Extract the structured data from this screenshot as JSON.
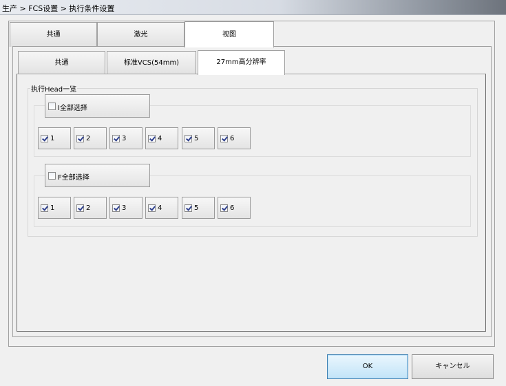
{
  "window": {
    "title": "生产 > FCS设置 > 执行条件设置"
  },
  "outer_tabs": [
    {
      "label": "共通",
      "active": false
    },
    {
      "label": "激光",
      "active": false
    },
    {
      "label": "视图",
      "active": true
    }
  ],
  "inner_tabs": [
    {
      "label": "共通",
      "active": false
    },
    {
      "label": "标准VCS(54mm)",
      "active": false
    },
    {
      "label": "27mm高分辨率",
      "active": true
    }
  ],
  "execution_group": {
    "title": "执行Head一览",
    "head_groups": [
      {
        "select_all": {
          "label": "I全部选择",
          "checked": false
        },
        "heads": [
          {
            "label": "1",
            "checked": true
          },
          {
            "label": "2",
            "checked": true
          },
          {
            "label": "3",
            "checked": true
          },
          {
            "label": "4",
            "checked": true
          },
          {
            "label": "5",
            "checked": true
          },
          {
            "label": "6",
            "checked": true
          }
        ]
      },
      {
        "select_all": {
          "label": "F全部选择",
          "checked": false
        },
        "heads": [
          {
            "label": "1",
            "checked": true
          },
          {
            "label": "2",
            "checked": true
          },
          {
            "label": "3",
            "checked": true
          },
          {
            "label": "4",
            "checked": true
          },
          {
            "label": "5",
            "checked": true
          },
          {
            "label": "6",
            "checked": true
          }
        ]
      }
    ]
  },
  "buttons": {
    "ok": "OK",
    "cancel": "キャンセル"
  }
}
